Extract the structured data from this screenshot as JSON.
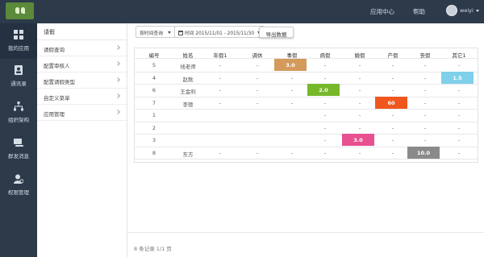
{
  "topbar": {
    "nav_app_center": "应用中心",
    "nav_help": "帮助",
    "username": "weiyi"
  },
  "leftnav": {
    "items": [
      {
        "label": "我的应用",
        "icon": "grid-icon"
      },
      {
        "label": "通讯录",
        "icon": "contacts-icon"
      },
      {
        "label": "组织架构",
        "icon": "org-chart-icon"
      },
      {
        "label": "群发消息",
        "icon": "message-icon"
      },
      {
        "label": "权限管理",
        "icon": "permission-icon"
      }
    ]
  },
  "subnav": {
    "title": "请假",
    "items": [
      {
        "label": "请假查询"
      },
      {
        "label": "配置审核人"
      },
      {
        "label": "配置请假类型"
      },
      {
        "label": "自定义菜单"
      },
      {
        "label": "应用管理"
      }
    ]
  },
  "toolbar": {
    "query_mode": "按时间查询",
    "date_range": "时间 2015/11/01 - 2015/11/30",
    "export_label": "导出数据"
  },
  "table": {
    "headers": [
      "编号",
      "姓名",
      "年假1",
      "调休",
      "事假",
      "病假",
      "婚假",
      "产假",
      "丧假",
      "其它1"
    ],
    "rows": [
      [
        "5",
        "线老师",
        "-",
        "-",
        "3.0",
        "-",
        "-",
        "-",
        "-",
        "-"
      ],
      [
        "4",
        "赵歌",
        "-",
        "-",
        "-",
        "-",
        "-",
        "-",
        "-",
        "1.5"
      ],
      [
        "6",
        "王金利",
        "-",
        "-",
        "-",
        "2.0",
        "-",
        "-",
        "-",
        "-"
      ],
      [
        "7",
        "李德",
        "-",
        "-",
        "-",
        "-",
        "-",
        "60",
        "-",
        "-"
      ],
      [
        "1",
        "",
        "",
        "",
        "",
        "-",
        "-",
        "-",
        "-",
        "-"
      ],
      [
        "2",
        "",
        "",
        "",
        "",
        "-",
        "-",
        "-",
        "-",
        "-"
      ],
      [
        "3",
        "",
        "",
        "",
        "",
        "-",
        "3.0",
        "-",
        "-",
        "-"
      ],
      [
        "8",
        "东方",
        "-",
        "-",
        "-",
        "-",
        "-",
        "-",
        "10.0",
        "-"
      ]
    ],
    "highlights": [
      {
        "row": 0,
        "col": 4,
        "color": "#d39a5c"
      },
      {
        "row": 1,
        "col": 9,
        "color": "#7fd0ea"
      },
      {
        "row": 2,
        "col": 5,
        "color": "#76b82a"
      },
      {
        "row": 3,
        "col": 7,
        "color": "#f0571f"
      },
      {
        "row": 6,
        "col": 6,
        "color": "#e8508f"
      },
      {
        "row": 7,
        "col": 8,
        "color": "#8a8a8a"
      }
    ]
  },
  "footer": {
    "summary": "8 条记录 1/1 页"
  }
}
